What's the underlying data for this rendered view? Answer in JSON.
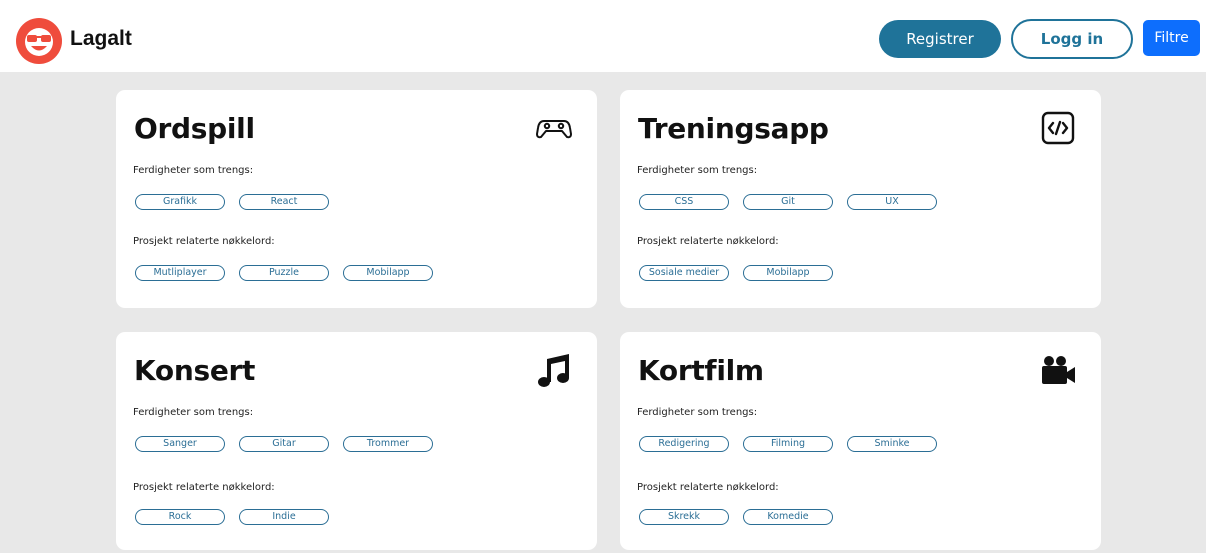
{
  "header": {
    "brand": "Lagalt",
    "register_label": "Registrer",
    "login_label": "Logg in",
    "filter_label": "Filtre"
  },
  "colors": {
    "accent": "#1f7399",
    "filter_blue": "#0d6efd",
    "logo_red": "#ef4c3c",
    "background": "#e8e8e8"
  },
  "projects": [
    {
      "title": "Ordspill",
      "icon": "gamepad-icon",
      "skills_label": "Ferdigheter som trengs:",
      "skills": [
        "Grafikk",
        "React"
      ],
      "keywords_label": "Prosjekt relaterte nøkkelord:",
      "keywords": [
        "Mutliplayer",
        "Puzzle",
        "Mobilapp"
      ]
    },
    {
      "title": "Treningsapp",
      "icon": "code-icon",
      "skills_label": "Ferdigheter som trengs:",
      "skills": [
        "CSS",
        "Git",
        "UX"
      ],
      "keywords_label": "Prosjekt relaterte nøkkelord:",
      "keywords": [
        "Sosiale medier",
        "Mobilapp"
      ]
    },
    {
      "title": "Konsert",
      "icon": "music-note-icon",
      "skills_label": "Ferdigheter som trengs:",
      "skills": [
        "Sanger",
        "Gitar",
        "Trommer"
      ],
      "keywords_label": "Prosjekt relaterte nøkkelord:",
      "keywords": [
        "Rock",
        "Indie"
      ]
    },
    {
      "title": "Kortfilm",
      "icon": "video-camera-icon",
      "skills_label": "Ferdigheter som trengs:",
      "skills": [
        "Redigering",
        "Filming",
        "Sminke"
      ],
      "keywords_label": "Prosjekt relaterte nøkkelord:",
      "keywords": [
        "Skrekk",
        "Komedie"
      ]
    }
  ]
}
